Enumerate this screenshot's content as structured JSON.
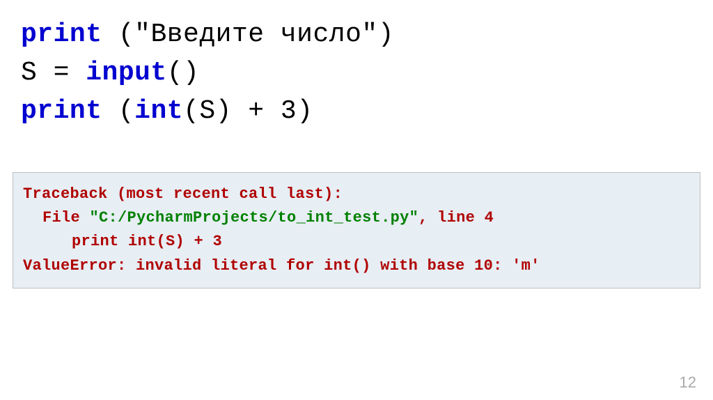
{
  "code": {
    "line1": {
      "kw": "print",
      "rest": " (\"Введите число\")"
    },
    "line2": {
      "pre": "S = ",
      "kw": "input",
      "post": "()"
    },
    "line3": {
      "kw1": "print",
      "mid": " (",
      "kw2": "int",
      "post1": "(S) + ",
      "num": "3",
      "post2": ")"
    }
  },
  "traceback": {
    "line1": "Traceback (most recent call last):",
    "line2_pre": "File ",
    "line2_path": "\"C:/PycharmProjects/to_int_test.py\"",
    "line2_post": ", line 4",
    "line3": "print int(S) + 3",
    "line4": "ValueError: invalid literal for int() with base 10:  'm'"
  },
  "page_number": "12"
}
